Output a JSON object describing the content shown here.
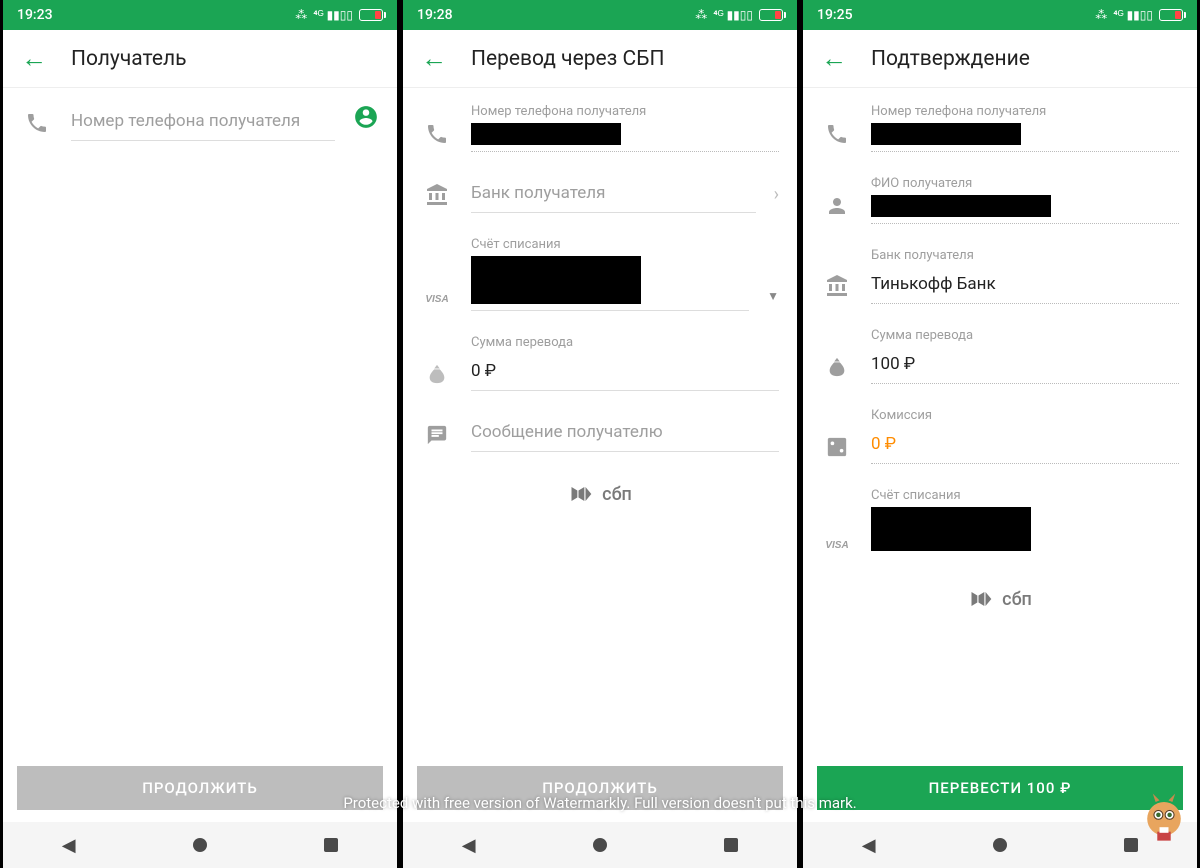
{
  "watermark_text": "Protected with free version of Watermarkly. Full version doesn't put this mark.",
  "sbp_label": "сбп",
  "screens": [
    {
      "time": "19:23",
      "title": "Получатель",
      "phone_placeholder": "Номер телефона получателя",
      "button": "ПРОДОЛЖИТЬ",
      "button_enabled": false
    },
    {
      "time": "19:28",
      "title": "Перевод через СБП",
      "fields": {
        "phone_label": "Номер телефона получателя",
        "bank_placeholder": "Банк получателя",
        "account_label": "Счёт списания",
        "amount_label": "Сумма перевода",
        "amount_value": "0 ₽",
        "message_placeholder": "Сообщение получателю"
      },
      "button": "ПРОДОЛЖИТЬ",
      "button_enabled": false
    },
    {
      "time": "19:25",
      "title": "Подтверждение",
      "fields": {
        "phone_label": "Номер телефона получателя",
        "name_label": "ФИО получателя",
        "bank_label": "Банк получателя",
        "bank_value": "Тинькофф Банк",
        "amount_label": "Сумма перевода",
        "amount_value": "100 ₽",
        "fee_label": "Комиссия",
        "fee_value": "0 ₽",
        "account_label": "Счёт списания"
      },
      "button": "ПЕРЕВЕСТИ 100 ₽",
      "button_enabled": true
    }
  ]
}
